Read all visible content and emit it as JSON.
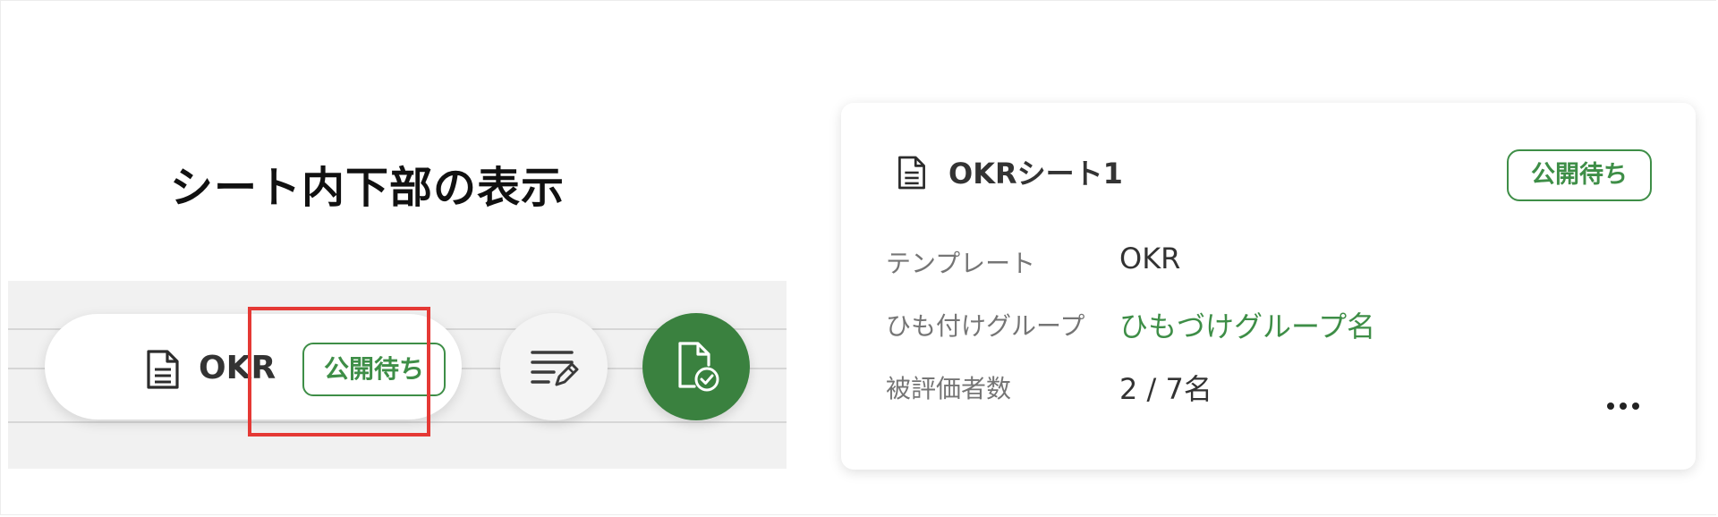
{
  "section_title": "シート内下部の表示",
  "sheet_bar": {
    "doc_icon": "document-icon",
    "label": "OKR",
    "status_badge": "公開待ち",
    "edit_button_icon": "edit-list-icon",
    "submit_button_icon": "document-check-icon"
  },
  "card": {
    "doc_icon": "document-icon",
    "title": "OKRシート1",
    "status_badge": "公開待ち",
    "fields": [
      {
        "label": "テンプレート",
        "value": "OKR"
      },
      {
        "label": "ひも付けグループ",
        "value": "ひもづけグループ名"
      },
      {
        "label": "被評価者数",
        "value": "2 / 7名"
      }
    ],
    "more_icon": "more-horizontal-icon"
  },
  "colors": {
    "accent_green": "#3e8e47",
    "button_green": "#3a813f",
    "highlight_red": "#e53935"
  }
}
